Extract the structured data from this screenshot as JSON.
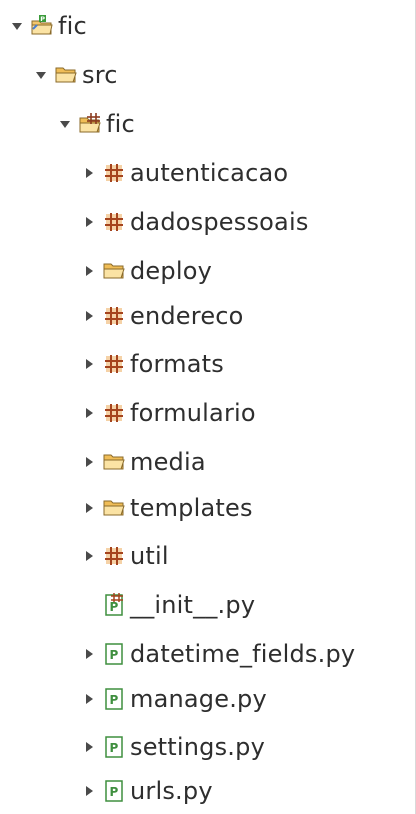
{
  "project_explorer": {
    "items": [
      {
        "label": "fic",
        "icon": "python-project-icon",
        "twisty": "expanded"
      },
      {
        "label": "src",
        "icon": "source-folder-icon",
        "twisty": "expanded"
      },
      {
        "label": "fic",
        "icon": "python-package-icon",
        "twisty": "expanded"
      },
      {
        "label": "autenticacao",
        "icon": "python-package-icon",
        "twisty": "collapsed"
      },
      {
        "label": "dadospessoais",
        "icon": "python-package-icon",
        "twisty": "collapsed"
      },
      {
        "label": "deploy",
        "icon": "folder-icon",
        "twisty": "collapsed"
      },
      {
        "label": "endereco",
        "icon": "python-package-icon",
        "twisty": "collapsed"
      },
      {
        "label": "formats",
        "icon": "python-package-icon",
        "twisty": "collapsed"
      },
      {
        "label": "formulario",
        "icon": "python-package-icon",
        "twisty": "collapsed"
      },
      {
        "label": "media",
        "icon": "folder-icon",
        "twisty": "collapsed"
      },
      {
        "label": "templates",
        "icon": "folder-icon",
        "twisty": "collapsed"
      },
      {
        "label": "util",
        "icon": "python-package-icon",
        "twisty": "collapsed"
      },
      {
        "label": "__init__.py",
        "icon": "python-init-file-icon",
        "twisty": "none"
      },
      {
        "label": "datetime_fields.py",
        "icon": "python-file-icon",
        "twisty": "collapsed"
      },
      {
        "label": "manage.py",
        "icon": "python-file-icon",
        "twisty": "collapsed"
      },
      {
        "label": "settings.py",
        "icon": "python-file-icon",
        "twisty": "collapsed"
      },
      {
        "label": "urls.py",
        "icon": "python-file-icon",
        "twisty": "collapsed"
      }
    ]
  }
}
